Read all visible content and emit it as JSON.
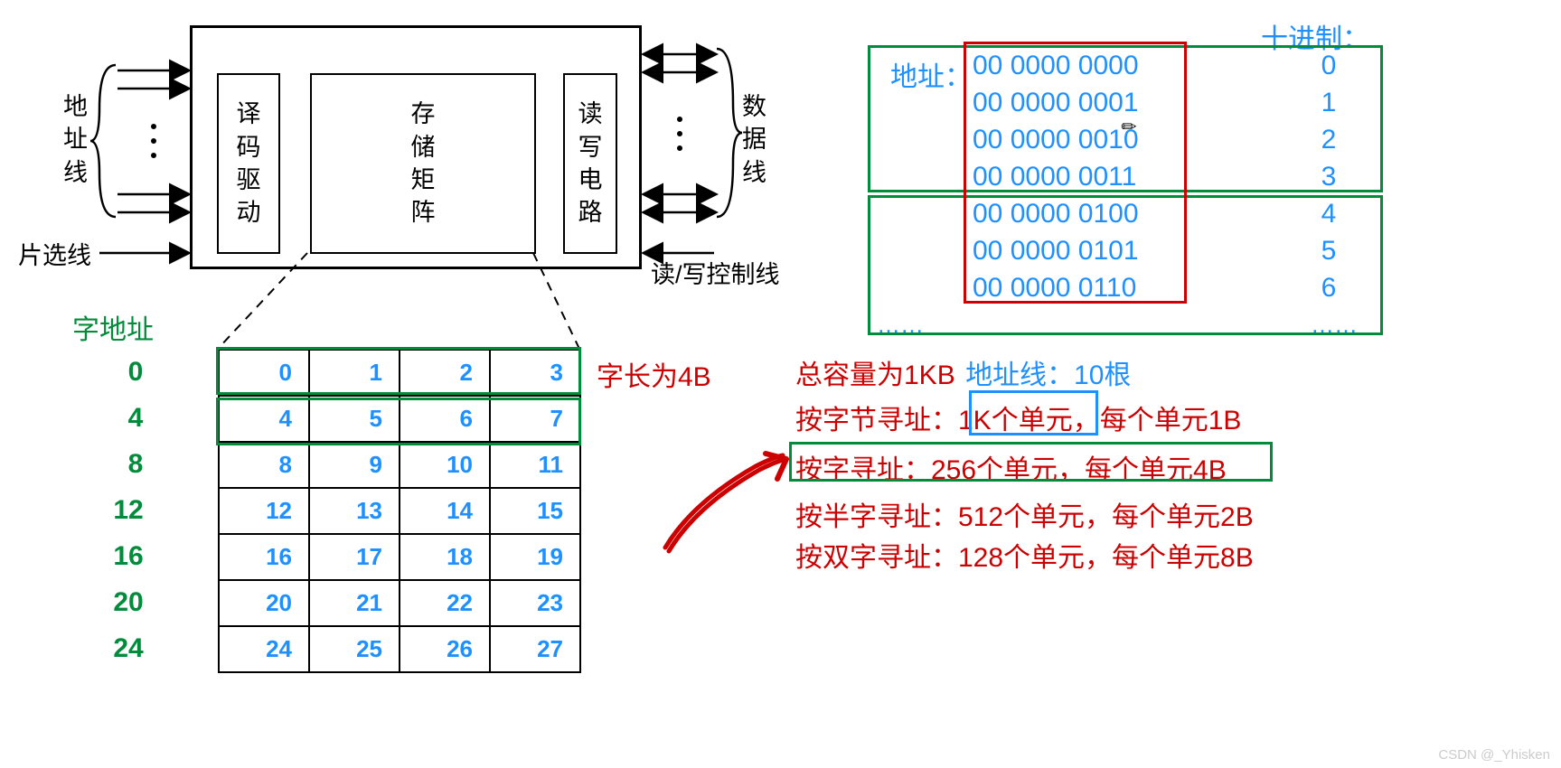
{
  "memory_module": {
    "decoder": "译\n码\n驱\n动",
    "matrix": "存\n储\n矩\n阵",
    "rw": "读\n写\n电\n路",
    "addr_line_label": "地\n址\n线",
    "data_line_label": "数\n据\n线",
    "chip_select_label": "片选线",
    "rw_ctrl_label": "读/写控制线"
  },
  "word_addr": {
    "title": "字地址",
    "labels": [
      "0",
      "4",
      "8",
      "12",
      "16",
      "20",
      "24"
    ],
    "rows": [
      [
        "0",
        "1",
        "2",
        "3"
      ],
      [
        "4",
        "5",
        "6",
        "7"
      ],
      [
        "8",
        "9",
        "10",
        "11"
      ],
      [
        "12",
        "13",
        "14",
        "15"
      ],
      [
        "16",
        "17",
        "18",
        "19"
      ],
      [
        "20",
        "21",
        "22",
        "23"
      ],
      [
        "24",
        "25",
        "26",
        "27"
      ]
    ],
    "wordlen_label": "字长为4B"
  },
  "addr_list": {
    "header_dec": "十进制：",
    "header_addr": "地址：",
    "bin": [
      "00 0000 0000",
      "00 0000 0001",
      "00 0000 0010",
      "00 0000 0011",
      "00 0000 0100",
      "00 0000 0101",
      "00 0000 0110"
    ],
    "dec": [
      "0",
      "1",
      "2",
      "3",
      "4",
      "5",
      "6"
    ],
    "ellipsis": "……"
  },
  "desc": {
    "total": "总容量为1KB",
    "addr_lines_label": "地址线：10根",
    "byte_addr": "按字节寻址：1K个单元，每个单元1B",
    "word_addr": "按字寻址：256个单元，每个单元4B",
    "half_addr": "按半字寻址：512个单元，每个单元2B",
    "double_addr": "按双字寻址：128个单元，每个单元8B"
  },
  "watermark": "CSDN @_Yhisken",
  "chart_data": {
    "type": "table",
    "title": "Memory addressing modes for 1KB memory, word length 4B",
    "word_address_table": {
      "word_addresses": [
        0,
        4,
        8,
        12,
        16,
        20,
        24
      ],
      "byte_addresses": [
        [
          0,
          1,
          2,
          3
        ],
        [
          4,
          5,
          6,
          7
        ],
        [
          8,
          9,
          10,
          11
        ],
        [
          12,
          13,
          14,
          15
        ],
        [
          16,
          17,
          18,
          19
        ],
        [
          20,
          21,
          22,
          23
        ],
        [
          24,
          25,
          26,
          27
        ]
      ]
    },
    "binary_address_table": {
      "binary": [
        "00 0000 0000",
        "00 0000 0001",
        "00 0000 0010",
        "00 0000 0011",
        "00 0000 0100",
        "00 0000 0101",
        "00 0000 0110"
      ],
      "decimal": [
        0,
        1,
        2,
        3,
        4,
        5,
        6
      ]
    },
    "summary": {
      "total_capacity_bytes": 1024,
      "address_lines": 10,
      "byte_addressing": {
        "units": 1024,
        "unit_size_bytes": 1
      },
      "word_addressing": {
        "units": 256,
        "unit_size_bytes": 4
      },
      "halfword_addressing": {
        "units": 512,
        "unit_size_bytes": 2
      },
      "doubleword_addressing": {
        "units": 128,
        "unit_size_bytes": 8
      }
    }
  }
}
